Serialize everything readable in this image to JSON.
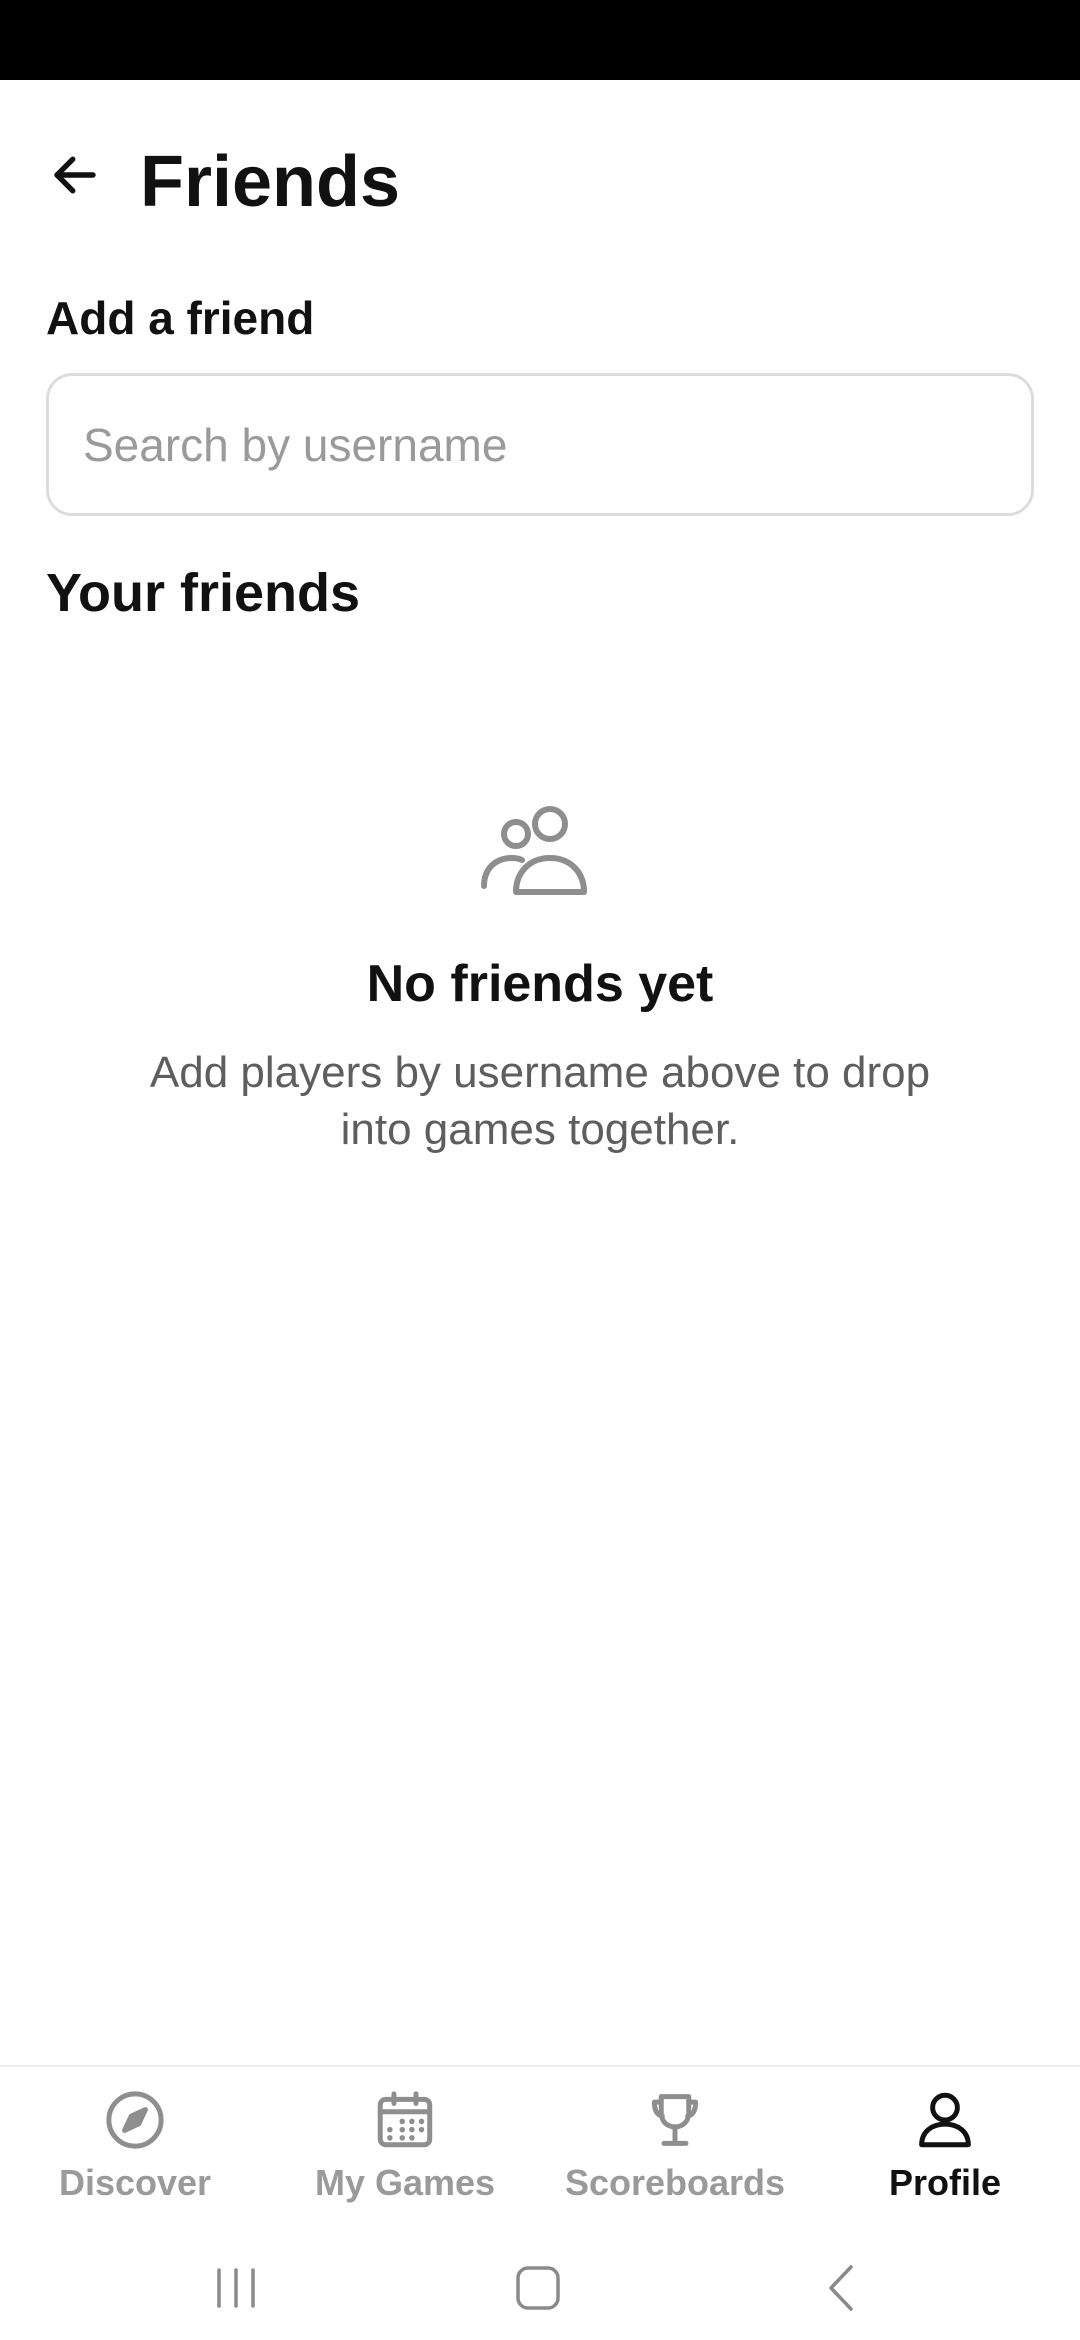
{
  "header": {
    "title": "Friends"
  },
  "add_friend": {
    "label": "Add a friend",
    "search": {
      "placeholder": "Search by username",
      "value": ""
    }
  },
  "friends_section": {
    "label": "Your friends"
  },
  "empty_state": {
    "icon": "users-icon",
    "title": "No friends yet",
    "description": "Add players by username above to drop into games together."
  },
  "bottom_nav": {
    "items": [
      {
        "label": "Discover",
        "icon": "compass-icon",
        "active": false
      },
      {
        "label": "My Games",
        "icon": "calendar-icon",
        "active": false
      },
      {
        "label": "Scoreboards",
        "icon": "trophy-icon",
        "active": false
      },
      {
        "label": "Profile",
        "icon": "person-icon",
        "active": true
      }
    ]
  },
  "colors": {
    "text_primary": "#111111",
    "text_muted": "#9a9a9a",
    "text_secondary": "#5e5e5e",
    "border": "#dcdcdc",
    "status_bar": "#000000"
  }
}
